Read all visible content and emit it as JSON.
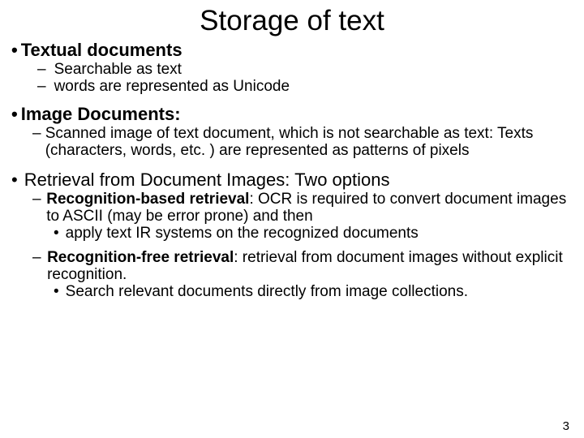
{
  "title": "Storage of text",
  "sections": {
    "s1": {
      "head": "Textual documents",
      "i1": "Searchable as text",
      "i2": "words are represented as Unicode"
    },
    "s2": {
      "head": "Image Documents:",
      "i1": "Scanned image of text document, which is not searchable as text: Texts (characters, words, etc. ) are  represented as patterns of pixels"
    },
    "s3": {
      "head": "Retrieval from Document Images: Two options",
      "i1_bold": "Recognition-based retrieval",
      "i1_rest": ": OCR is required to convert document images to ASCII (may be error prone) and then",
      "i1_sub": "apply text IR systems on the recognized documents",
      "i2_bold": "Recognition-free retrieval",
      "i2_rest": ": retrieval from document images without explicit recognition.",
      "i2_sub": "Search relevant documents directly from image collections."
    }
  },
  "page_number": "3"
}
